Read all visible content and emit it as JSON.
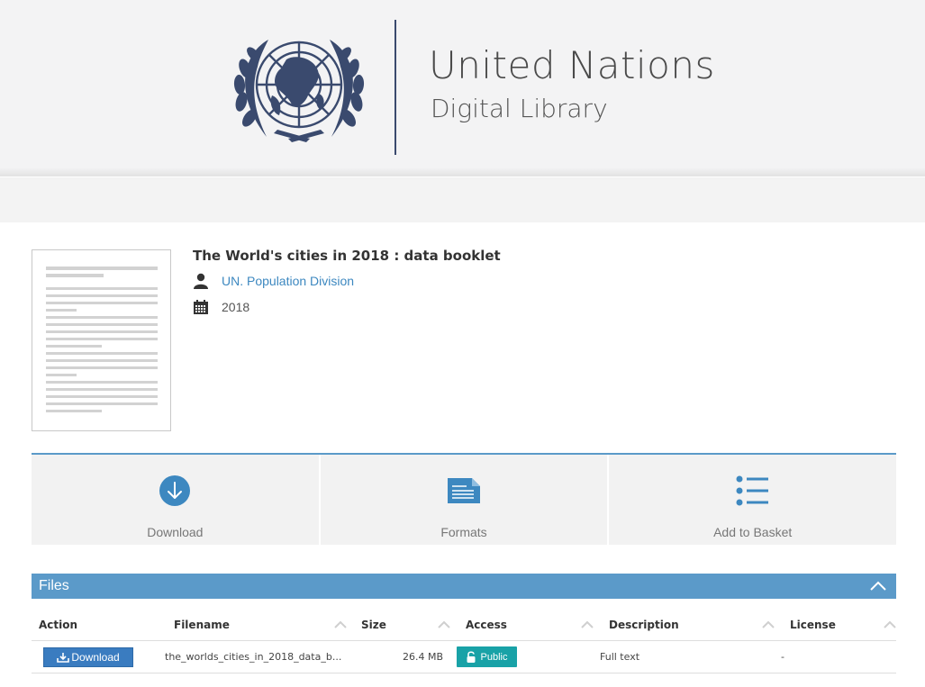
{
  "brand": {
    "title": "United Nations",
    "subtitle": "Digital Library",
    "emblem_icon": "un-emblem-icon",
    "color": "#3a4a6e"
  },
  "record": {
    "title": "The World's cities in 2018 : data booklet",
    "author": "UN. Population Division",
    "year": "2018",
    "author_icon": "person-icon",
    "year_icon": "calendar-icon"
  },
  "actions": [
    {
      "label": "Download",
      "icon": "download-circle-icon"
    },
    {
      "label": "Formats",
      "icon": "document-icon"
    },
    {
      "label": "Add to Basket",
      "icon": "list-icon"
    }
  ],
  "files": {
    "section_title": "Files",
    "columns": [
      "Action",
      "Filename",
      "Size",
      "Access",
      "Description",
      "License"
    ],
    "rows": [
      {
        "action": "Download",
        "filename": "the_worlds_cities_in_2018_data_b...",
        "size": "26.4 MB",
        "access": "Public",
        "description": "Full text",
        "license": "-"
      }
    ]
  },
  "colors": {
    "accent": "#5b9ac9",
    "link": "#3d88c0",
    "button": "#3a7cc0",
    "public_badge": "#19a2a7"
  }
}
